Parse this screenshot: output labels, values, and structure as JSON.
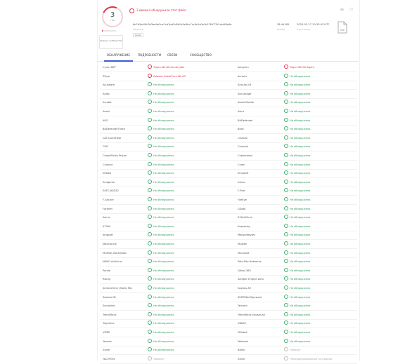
{
  "score": {
    "detections": "3",
    "total": "/ 58",
    "bar_fraction": 0.05
  },
  "community": {
    "label": "Оценка сообщества"
  },
  "alert": {
    "text": "3 движка обнаружили этот файл"
  },
  "file": {
    "name": "bb7e5a49fc3d3ae9a3ca7cd1bd2c8b1b5e3bc7cc8c0a0e3c07f4f77b2cb4f6d4e",
    "sub": "setup.exe",
    "tag": "peexe"
  },
  "meta": {
    "size": "38.44 MB",
    "size_label": "Размер",
    "date": "2020-02-17 10:33:43 UTC",
    "date_label": "2 дня назад"
  },
  "file_icon": {
    "ext": "EXE"
  },
  "tabs": [
    {
      "label": "ОБНАРУЖЕНИЕ",
      "active": true
    },
    {
      "label": "ПОДРОБНОСТИ",
      "active": false
    },
    {
      "label": "СВЯЗИ",
      "active": false
    },
    {
      "label": "СООБЩЕСТВО",
      "active": false
    }
  ],
  "detections": [
    {
      "e1": "Cyren-NET",
      "r1": "Trojan.Win32.GenKryptik",
      "s1": "bad",
      "e2": "Jiangmin",
      "r2": "Trojan.Win32.Agent",
      "s2": "bad"
    },
    {
      "e1": "Zillya",
      "r1": "Adware.InstallCore.Win32",
      "s1": "bad",
      "e2": "Acronis",
      "r2": "Не обнаружено",
      "s2": "ok"
    },
    {
      "e1": "Ad-Aware",
      "r1": "Не обнаружено",
      "s1": "ok",
      "e2": "AhnLab-V3",
      "r2": "Не обнаружено",
      "s2": "ok"
    },
    {
      "e1": "ALYac",
      "r1": "Не обнаружено",
      "s1": "ok",
      "e2": "SecureAge",
      "r2": "Не обнаружено",
      "s2": "ok"
    },
    {
      "e1": "Arcabit",
      "r1": "Не обнаружено",
      "s1": "ok",
      "e2": "Avast-Mobile",
      "r2": "Не обнаружено",
      "s2": "ok"
    },
    {
      "e1": "Avast",
      "r1": "Не обнаружено",
      "s1": "ok",
      "e2": "Avira",
      "r2": "Не обнаружено",
      "s2": "ok"
    },
    {
      "e1": "AVG",
      "r1": "Не обнаружено",
      "s1": "ok",
      "e2": "BitDefender",
      "r2": "Не обнаружено",
      "s2": "ok"
    },
    {
      "e1": "BitDefenderTheta",
      "r1": "Не обнаружено",
      "s1": "ok",
      "e2": "Bkav",
      "r2": "Не обнаружено",
      "s2": "ok"
    },
    {
      "e1": "CAT-QuickHeal",
      "r1": "Не обнаружено",
      "s1": "ok",
      "e2": "ClamAV",
      "r2": "Не обнаружено",
      "s2": "ok"
    },
    {
      "e1": "CMC",
      "r1": "Не обнаружено",
      "s1": "ok",
      "e2": "Comodo",
      "r2": "Не обнаружено",
      "s2": "ok"
    },
    {
      "e1": "CrowdStrike Falcon",
      "r1": "Не обнаружено",
      "s1": "ok",
      "e2": "Cybereason",
      "r2": "Не обнаружено",
      "s2": "ok"
    },
    {
      "e1": "Cylance",
      "r1": "Не обнаружено",
      "s1": "ok",
      "e2": "Cyren",
      "r2": "Не обнаружено",
      "s2": "ok"
    },
    {
      "e1": "DrWeb",
      "r1": "Не обнаружено",
      "s1": "ok",
      "e2": "Emsisoft",
      "r2": "Не обнаружено",
      "s2": "ok"
    },
    {
      "e1": "Endgame",
      "r1": "Не обнаружено",
      "s1": "ok",
      "e2": "eScan",
      "r2": "Не обнаружено",
      "s2": "ok"
    },
    {
      "e1": "ESET-NOD32",
      "r1": "Не обнаружено",
      "s1": "ok",
      "e2": "F-Prot",
      "r2": "Не обнаружено",
      "s2": "ok"
    },
    {
      "e1": "F-Secure",
      "r1": "Не обнаружено",
      "s1": "ok",
      "e2": "FireEye",
      "r2": "Не обнаружено",
      "s2": "ok"
    },
    {
      "e1": "Fortinet",
      "r1": "Не обнаружено",
      "s1": "ok",
      "e2": "GData",
      "r2": "Не обнаружено",
      "s2": "ok"
    },
    {
      "e1": "Ikarus",
      "r1": "Не обнаружено",
      "s1": "ok",
      "e2": "K7AntiVirus",
      "r2": "Не обнаружено",
      "s2": "ok"
    },
    {
      "e1": "K7GW",
      "r1": "Не обнаружено",
      "s1": "ok",
      "e2": "Kaspersky",
      "r2": "Не обнаружено",
      "s2": "ok"
    },
    {
      "e1": "Kingsoft",
      "r1": "Не обнаружено",
      "s1": "ok",
      "e2": "Malwarebytes",
      "r2": "Не обнаружено",
      "s2": "ok"
    },
    {
      "e1": "MaxSecure",
      "r1": "Не обнаружено",
      "s1": "ok",
      "e2": "McAfee",
      "r2": "Не обнаружено",
      "s2": "ok"
    },
    {
      "e1": "McAfee-GW-Edition",
      "r1": "Не обнаружено",
      "s1": "ok",
      "e2": "Microsoft",
      "r2": "Не обнаружено",
      "s2": "ok"
    },
    {
      "e1": "NANO-Antivirus",
      "r1": "Не обнаружено",
      "s1": "ok",
      "e2": "Palo Alto Networks",
      "r2": "Не обнаружено",
      "s2": "ok"
    },
    {
      "e1": "Panda",
      "r1": "Не обнаружено",
      "s1": "ok",
      "e2": "Qihoo-360",
      "r2": "Не обнаружено",
      "s2": "ok"
    },
    {
      "e1": "Rising",
      "r1": "Не обнаружено",
      "s1": "ok",
      "e2": "Sangfor Engine Zero",
      "r2": "Не обнаружено",
      "s2": "ok"
    },
    {
      "e1": "SentinelOne (Static ML)",
      "r1": "Не обнаружено",
      "s1": "ok",
      "e2": "Sophos AV",
      "r2": "Не обнаружено",
      "s2": "ok"
    },
    {
      "e1": "Sophos ML",
      "r1": "Не обнаружено",
      "s1": "ok",
      "e2": "SUPERAntiSpyware",
      "r2": "Не обнаружено",
      "s2": "ok"
    },
    {
      "e1": "Symantec",
      "r1": "Не обнаружено",
      "s1": "ok",
      "e2": "Tencent",
      "r2": "Не обнаружено",
      "s2": "ok"
    },
    {
      "e1": "TrendMicro",
      "r1": "Не обнаружено",
      "s1": "ok",
      "e2": "TrendMicro-HouseCall",
      "r2": "Не обнаружено",
      "s2": "ok"
    },
    {
      "e1": "Trapmine",
      "r1": "Не обнаружено",
      "s1": "ok",
      "e2": "VBA32",
      "r2": "Не обнаружено",
      "s2": "ok"
    },
    {
      "e1": "VIPRE",
      "r1": "Не обнаружено",
      "s1": "ok",
      "e2": "ViRobot",
      "r2": "Не обнаружено",
      "s2": "ok"
    },
    {
      "e1": "Yandex",
      "r1": "Не обнаружено",
      "s1": "ok",
      "e2": "Webroot",
      "r2": "Не обнаружено",
      "s2": "ok"
    },
    {
      "e1": "Zoner",
      "r1": "Не обнаружено",
      "s1": "ok",
      "e2": "Baidu",
      "r2": "Таймаут",
      "s2": "na"
    },
    {
      "e1": "TACHYON",
      "r1": "Таймаут",
      "s1": "na",
      "e2": "Zoner",
      "r2": "Неподдерживаемый тип файла",
      "s2": "na"
    }
  ]
}
